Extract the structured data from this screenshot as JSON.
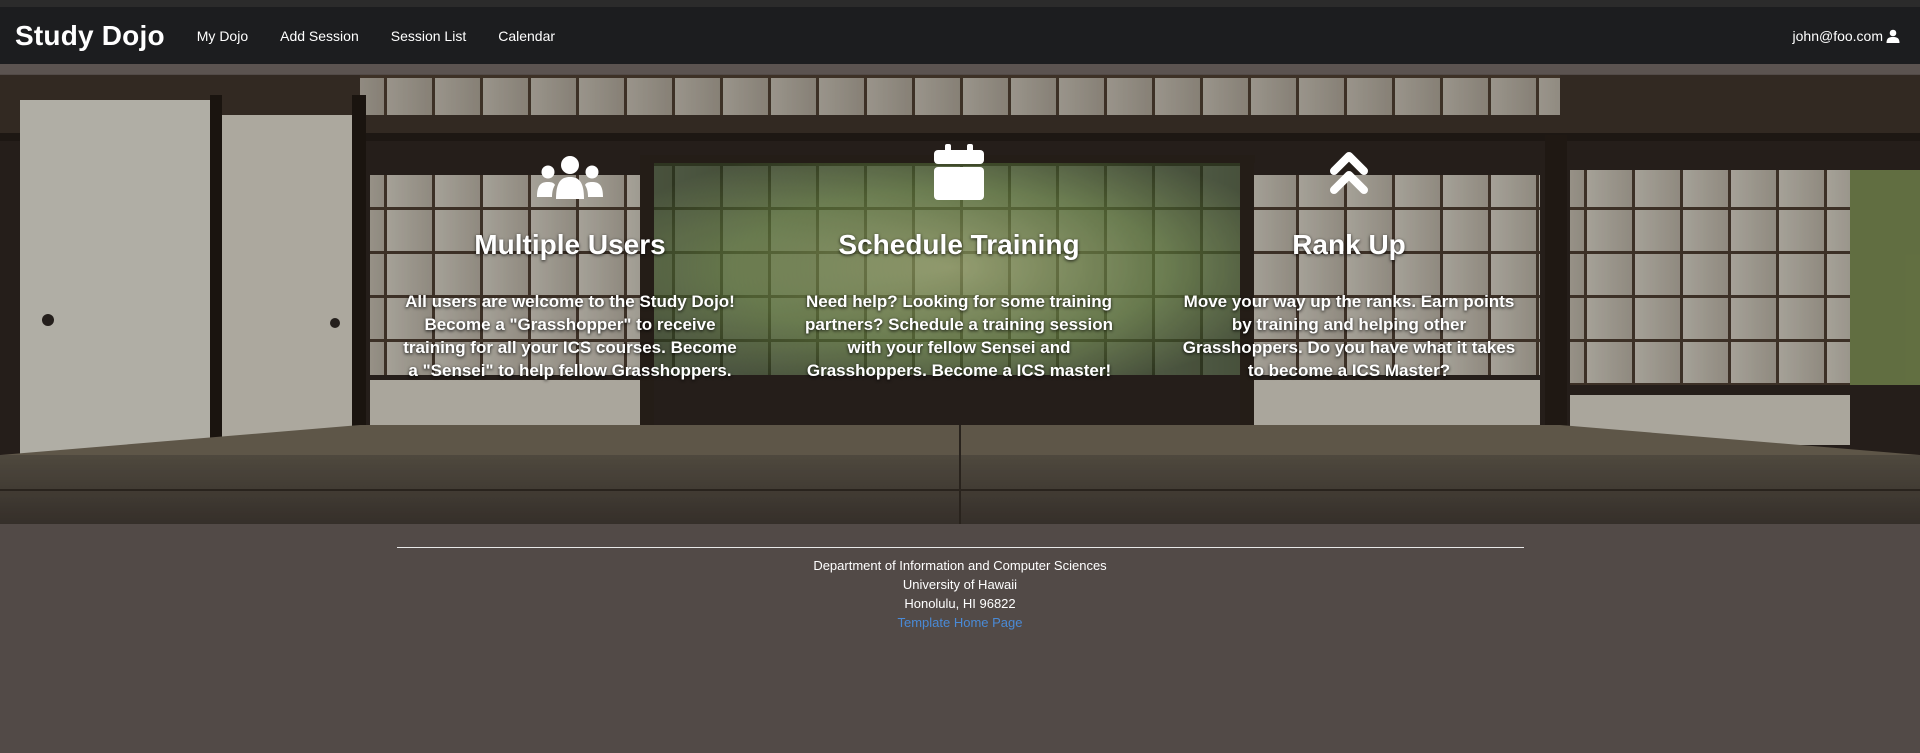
{
  "navbar": {
    "brand": "Study Dojo",
    "links": [
      "My Dojo",
      "Add Session",
      "Session List",
      "Calendar"
    ],
    "user": "john@foo.com"
  },
  "features": [
    {
      "icon": "users-icon",
      "title": "Multiple Users",
      "text": "All users are welcome to the Study Dojo! Become a \"Grasshopper\" to receive training for all your ICS courses. Become a \"Sensei\" to help fellow Grasshoppers."
    },
    {
      "icon": "calendar-icon",
      "title": "Schedule Training",
      "text": "Need help? Looking for some training partners? Schedule a training session with your fellow Sensei and Grasshoppers. Become a ICS master!"
    },
    {
      "icon": "double-chevron-up-icon",
      "title": "Rank Up",
      "text": "Move your way up the ranks. Earn points by training and helping other Grasshoppers. Do you have what it takes to become a ICS Master?"
    }
  ],
  "footer": {
    "lines": [
      "Department of Information and Computer Sciences",
      "University of Hawaii",
      "Honolulu, HI 96822"
    ],
    "link": "Template Home Page"
  },
  "colors": {
    "navbar_bg": "#1c1d1f",
    "page_bg": "#524a47",
    "link": "#4a8ad6"
  }
}
